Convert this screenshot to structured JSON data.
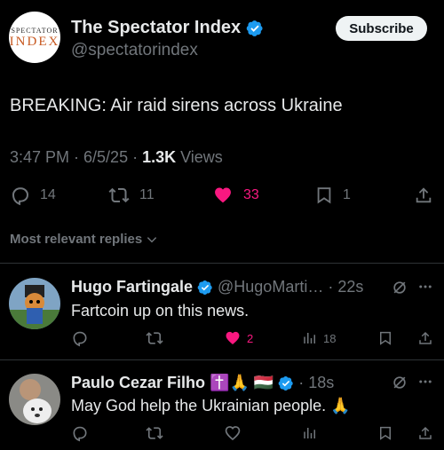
{
  "account": {
    "name": "The Spectator Index",
    "handle": "@spectatorindex",
    "avatar_line1": "SPECTATOR",
    "avatar_line2": "INDEX",
    "subscribe_label": "Subscribe"
  },
  "tweet": {
    "text": "BREAKING: Air raid sirens across Ukraine",
    "time": "3:47 PM · 6/5/25 · ",
    "views_count": "1.3K",
    "views_label": " Views",
    "replies": "14",
    "reposts": "11",
    "likes": "33",
    "bookmarks": "1"
  },
  "replies_sort_label": "Most relevant replies",
  "replies": [
    {
      "name": "Hugo Fartingale",
      "handle_time": "@HugoMarti… · 22s",
      "text": "Fartcoin up on this news.",
      "likes": "2",
      "views": "18"
    },
    {
      "name": "Paulo Cezar Filho",
      "emoji": "✝️🙏 🇭🇺",
      "handle_time": "· 18s",
      "text": "May God help the Ukrainian people. 🙏"
    }
  ],
  "colors": {
    "background": "#000000",
    "text_primary": "#e7e9ea",
    "text_secondary": "#71767b",
    "verified_blue": "#1d9bf0",
    "like_pink": "#f91880",
    "divider": "#2f3336"
  }
}
